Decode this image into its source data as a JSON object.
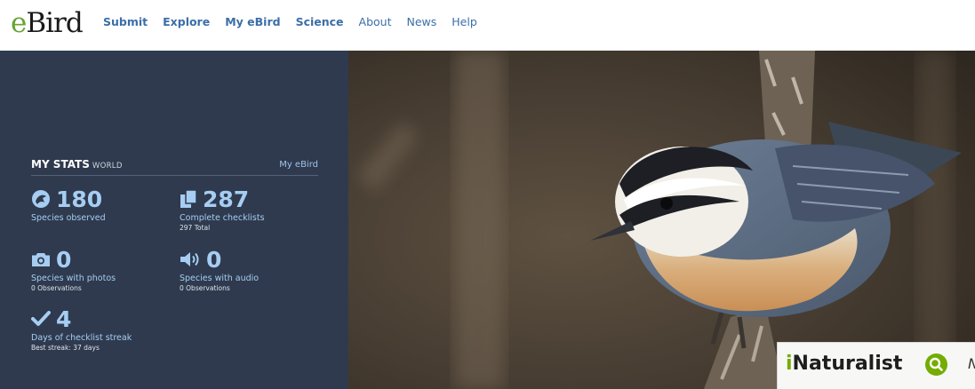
{
  "brand": {
    "name_e": "e",
    "name_rest": "Bird"
  },
  "nav": [
    {
      "label": "Submit",
      "bold": true
    },
    {
      "label": "Explore",
      "bold": true
    },
    {
      "label": "My eBird",
      "bold": true
    },
    {
      "label": "Science",
      "bold": true
    },
    {
      "label": "About",
      "bold": false
    },
    {
      "label": "News",
      "bold": false
    },
    {
      "label": "Help",
      "bold": false
    }
  ],
  "stats": {
    "title": "MY STATS",
    "scope": "WORLD",
    "link": "My eBird",
    "species": {
      "value": "180",
      "label": "Species observed"
    },
    "checklists": {
      "value": "287",
      "label": "Complete checklists",
      "sub": "297 Total"
    },
    "photos": {
      "value": "0",
      "label": "Species with photos",
      "sub": "0 Observations"
    },
    "audio": {
      "value": "0",
      "label": "Species with audio",
      "sub": "0 Observations"
    },
    "streak": {
      "value": "4",
      "label": "Days of checklist streak",
      "sub": "Best streak: 37 days"
    }
  },
  "inaturalist": {
    "name_i": "i",
    "name_rest": "Naturalist",
    "more": "N"
  },
  "colors": {
    "accent": "#a6cdf2",
    "panel": "#2f3a4e",
    "nav_link": "#3b6ea8",
    "inat_green": "#74ac00",
    "ebird_green": "#66a433"
  }
}
